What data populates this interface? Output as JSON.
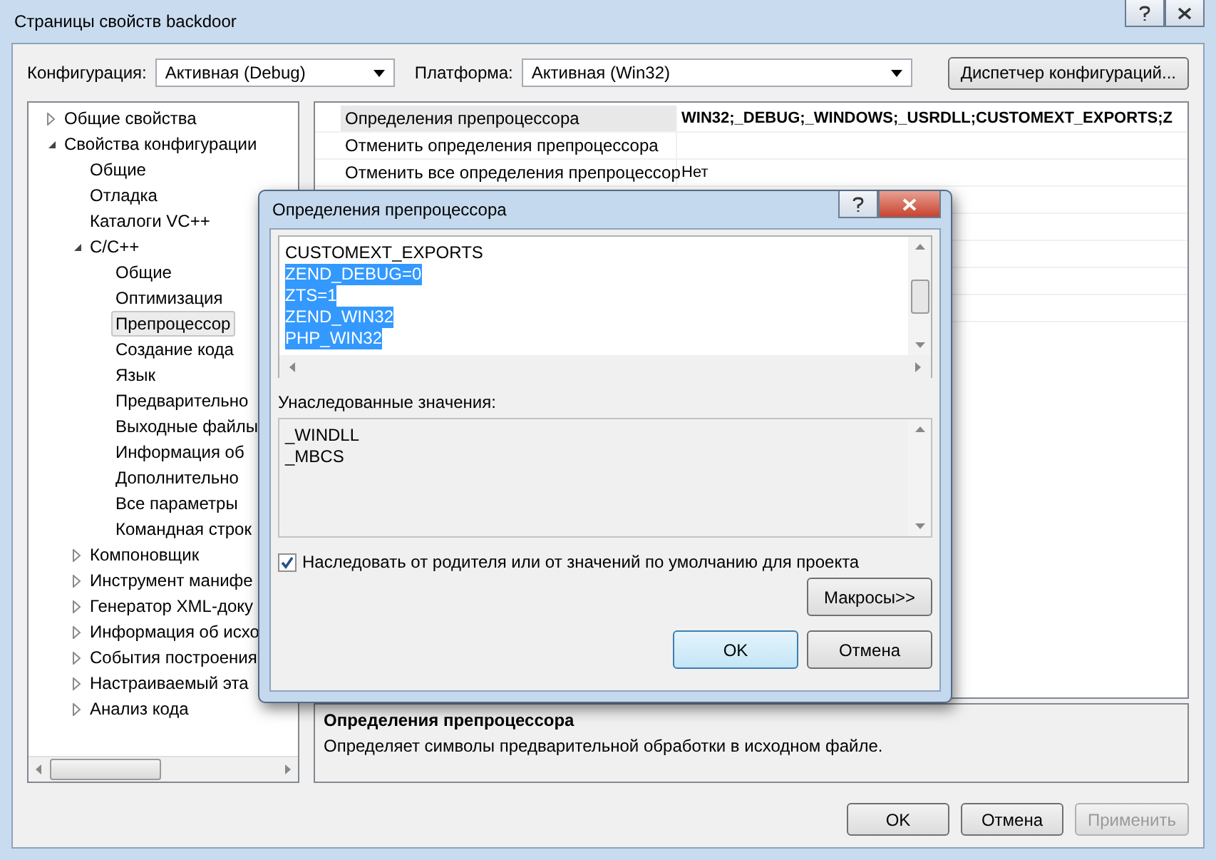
{
  "window": {
    "title": "Страницы свойств backdoor"
  },
  "toolbar": {
    "configuration_label": "Конфигурация:",
    "configuration_value": "Активная (Debug)",
    "platform_label": "Платформа:",
    "platform_value": "Активная (Win32)",
    "manager_button": "Диспетчер конфигураций..."
  },
  "tree": [
    {
      "label": "Общие свойства",
      "expanded": false,
      "selected": false
    },
    {
      "label": "Свойства конфигурации",
      "expanded": true,
      "selected": false,
      "children": [
        {
          "label": "Общие",
          "selected": false
        },
        {
          "label": "Отладка",
          "selected": false
        },
        {
          "label": "Каталоги VC++",
          "selected": false
        },
        {
          "label": "C/C++",
          "expanded": true,
          "selected": false,
          "children": [
            {
              "label": "Общие",
              "selected": false
            },
            {
              "label": "Оптимизация",
              "selected": false
            },
            {
              "label": "Препроцессор",
              "selected": true
            },
            {
              "label": "Создание кода",
              "selected": false
            },
            {
              "label": "Язык",
              "selected": false
            },
            {
              "label": "Предварительно",
              "selected": false
            },
            {
              "label": "Выходные файлы",
              "selected": false
            },
            {
              "label": "Информация об",
              "selected": false
            },
            {
              "label": "Дополнительно",
              "selected": false
            },
            {
              "label": "Все параметры",
              "selected": false
            },
            {
              "label": "Командная строк",
              "selected": false
            }
          ]
        },
        {
          "label": "Компоновщик",
          "expanded": false,
          "selected": false
        },
        {
          "label": "Инструмент манифе",
          "expanded": false,
          "selected": false
        },
        {
          "label": "Генератор XML-доку",
          "expanded": false,
          "selected": false
        },
        {
          "label": "Информация об исхо",
          "expanded": false,
          "selected": false
        },
        {
          "label": "События построения",
          "expanded": false,
          "selected": false
        },
        {
          "label": "Настраиваемый эта",
          "expanded": false,
          "selected": false
        },
        {
          "label": "Анализ кода",
          "expanded": false,
          "selected": false
        }
      ]
    }
  ],
  "properties": [
    {
      "name": "Определения препроцессора",
      "value": "WIN32;_DEBUG;_WINDOWS;_USRDLL;CUSTOMEXT_EXPORTS;Z",
      "selected": true
    },
    {
      "name": "Отменить определения препроцессора",
      "selected": false
    },
    {
      "name": "Отменить все определения препроцессор",
      "value": "Нет",
      "selected": false
    }
  ],
  "description": {
    "title": "Определения препроцессора",
    "text": "Определяет символы предварительной обработки в исходном файле."
  },
  "buttons": [
    {
      "label": "OK",
      "disabled": false
    },
    {
      "label": "Отмена",
      "disabled": false
    },
    {
      "label": "Применить",
      "disabled": true
    }
  ],
  "dialog": {
    "title": "Определения препроцессора",
    "lines": [
      {
        "text": "CUSTOMEXT_EXPORTS",
        "selected": false
      },
      {
        "text": "ZEND_DEBUG=0",
        "selected": true
      },
      {
        "text": "ZTS=1",
        "selected": true
      },
      {
        "text": "ZEND_WIN32",
        "selected": true
      },
      {
        "text": "PHP_WIN32",
        "selected": true
      }
    ],
    "inherited_label": "Унаследованные значения:",
    "inherited": [
      "_WINDLL",
      "_MBCS"
    ],
    "inherit_checkbox": {
      "label": "Наследовать от родителя или от значений по умолчанию для проекта",
      "checked": true
    },
    "macros_button": "Макросы>>",
    "buttons": [
      {
        "label": "OK",
        "default": true
      },
      {
        "label": "Отмена",
        "default": false
      }
    ]
  }
}
